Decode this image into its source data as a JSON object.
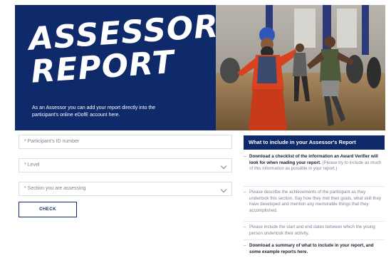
{
  "hero": {
    "title_line1": "ASSESSOR'S",
    "title_line2": "REPORT",
    "description": "As an Assessor you can add your report directly into the participant's online eDofE account here."
  },
  "form": {
    "participant_id_label": "* Participant's ID number",
    "level_label": "* Level",
    "section_label": "* Section you are assessing",
    "check_button": "CHECK"
  },
  "info": {
    "heading": "What to include in your Assessor's Report",
    "items": [
      {
        "dash": "–",
        "bold": "Download a checklist of the information an Award Verifier will look for when reading your report.",
        "text": " (Please try to include as much of this information as possible in your report.)"
      },
      {
        "dash": "–",
        "bold": "",
        "text": "Please describe the achievements of the participant as they undertook this section. Say how they met their goals, what skill they have developed and mention any memorable things that they accomplished."
      },
      {
        "dash": "–",
        "bold": "",
        "text": "Please include the start and end dates between which the young person undertook their activity."
      },
      {
        "dash": "–",
        "bold": "Download a summary of what to include in your report, and some example reports here.",
        "text": ""
      }
    ]
  },
  "colors": {
    "brand_navy": "#0f2a6b",
    "field_border": "#d8dde6",
    "muted_text": "#7a8396"
  }
}
